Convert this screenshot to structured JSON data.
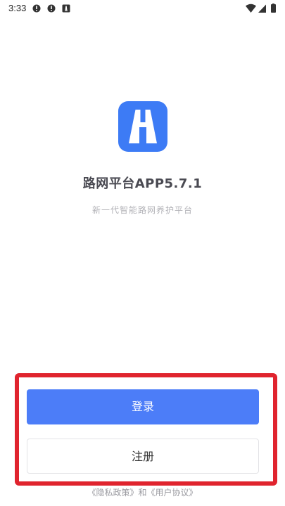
{
  "status_bar": {
    "time": "3:33",
    "left_icons": [
      "alert-icon",
      "alert-icon",
      "app-notification-icon"
    ],
    "right_icons": [
      "wifi-icon",
      "cell-signal-icon",
      "battery-icon"
    ]
  },
  "app": {
    "title": "路网平台APP5.7.1",
    "subtitle": "新一代智能路网养护平台",
    "logo_icon": "road-logo-icon",
    "brand_color": "#3d7bf5"
  },
  "actions": {
    "login_label": "登录",
    "register_label": "注册",
    "login_color": "#4c7df8",
    "highlight_color": "#e0242e"
  },
  "footer": {
    "agreement": "《隐私政策》和《用户协议》"
  }
}
